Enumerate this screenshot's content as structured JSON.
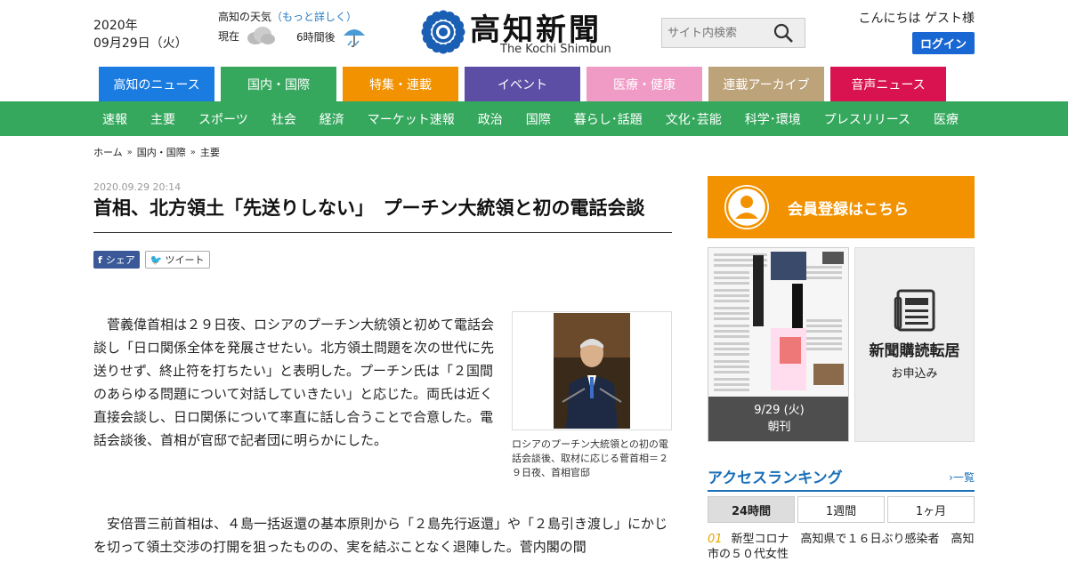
{
  "header": {
    "date_year": "2020年",
    "date_day": "09月29日（火）",
    "weather_title": "高知の天気",
    "weather_more": "（もっと詳しく）",
    "now_label": "現在",
    "later_label": "6時間後",
    "logo_jp": "高知新聞",
    "logo_en": "The Kochi Shimbun",
    "search_placeholder": "サイト内検索",
    "greeting": "こんにちは ゲスト様",
    "login_label": "ログイン"
  },
  "categories": [
    {
      "label": "高知のニュース",
      "color": "#1a7be0"
    },
    {
      "label": "国内・国際",
      "color": "#36a85e"
    },
    {
      "label": "特集・連載",
      "color": "#f29200"
    },
    {
      "label": "イベント",
      "color": "#5b4ea4"
    },
    {
      "label": "医療・健康",
      "color": "#f09ac6"
    },
    {
      "label": "連載アーカイブ",
      "color": "#bda37a"
    },
    {
      "label": "音声ニュース",
      "color": "#d9134f"
    }
  ],
  "subnav": [
    "速報",
    "主要",
    "スポーツ",
    "社会",
    "経済",
    "マーケット速報",
    "政治",
    "国際",
    "暮らし･話題",
    "文化･芸能",
    "科学･環境",
    "プレスリリース",
    "医療"
  ],
  "breadcrumb": [
    "ホーム",
    "国内・国際",
    "主要"
  ],
  "article": {
    "timestamp": "2020.09.29 20:14",
    "title": "首相、北方領土「先送りしない」　プーチン大統領と初の電話会談",
    "share_fb": "シェア",
    "share_tw": "ツイート",
    "para1": "菅義偉首相は２９日夜、ロシアのプーチン大統領と初めて電話会談し「日ロ関係全体を発展させたい。北方領土問題を次の世代に先送りせず、終止符を打ちたい」と表明した。プーチン氏は「２国間のあらゆる問題について対話していきたい」と応じた。両氏は近く直接会談し、日ロ関係について率直に話し合うことで合意した。電話会談後、首相が官邸で記者団に明らかにした。",
    "para2": "安倍晋三前首相は、４島一括返還の基本原則から「２島先行返還」や「２島引き渡し」にかじを切って領土交渉の打開を狙ったものの、実を結ぶことなく退陣した。菅内閣の間",
    "photo_caption": "ロシアのプーチン大統領との初の電話会談後、取材に応じる菅首相＝２９日夜、首相官邸"
  },
  "sidebar": {
    "member_label": "会員登録はこちら",
    "paper_date": "9/29 (火)",
    "paper_edition": "朝刊",
    "subscribe_title": "新聞購読転居",
    "subscribe_sub": "お申込み",
    "ranking_title": "アクセスランキング",
    "ranking_more": "一覧",
    "tabs": [
      "24時間",
      "1週間",
      "1ヶ月"
    ],
    "rank1_num": "01",
    "rank1_text": "新型コロナ　高知県で１６日ぶり感染者　高知市の５０代女性"
  }
}
